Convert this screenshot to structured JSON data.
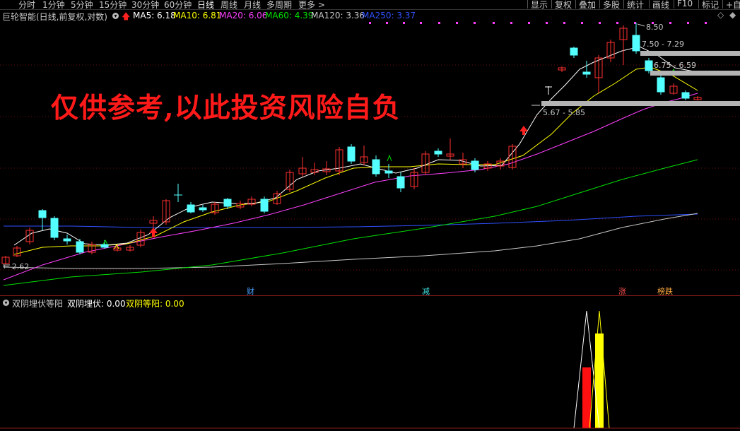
{
  "periods": [
    "分时",
    "1分钟",
    "5分钟",
    "15分钟",
    "30分钟",
    "60分钟",
    "日线",
    "周线",
    "月线",
    "多周期",
    "更多 >"
  ],
  "active_period": "日线",
  "toolbar": [
    "显示",
    "复权",
    "叠加",
    "多股",
    "统计",
    "画线",
    "F10",
    "标记",
    "+自"
  ],
  "stock_title": "巨轮智能(日线,前复权,对数)",
  "ma": [
    {
      "label": "MA5: 6.18",
      "color": "#ffffff"
    },
    {
      "label": "MA10: 6.81",
      "color": "#ffff00"
    },
    {
      "label": "MA20: 6.06",
      "color": "#ff40ff"
    },
    {
      "label": "MA60: 4.39",
      "color": "#00e000"
    },
    {
      "label": "MA120: 3.36",
      "color": "#c8c8c8"
    },
    {
      "label": "MA250: 3.37",
      "color": "#3050ff"
    }
  ],
  "watermark": "仅供参考,以此投资风险自负",
  "price_labels": {
    "high": "8.50",
    "band1": "7.50 - 7.29",
    "band2": "6.75 - 6.59",
    "band3": "5.67 - 5.85",
    "low": "← 2.62"
  },
  "event_tags": [
    {
      "text": "财",
      "color": "#4aa0ff"
    },
    {
      "text": "减",
      "color": "#40e0e0"
    },
    {
      "text": "涨",
      "color": "#ff5050"
    },
    {
      "text": "榜跌",
      "color": "#ffaa40"
    }
  ],
  "indicator": {
    "name": "双阴埋伏等阳",
    "line1": "双阴埋伏: 0.00",
    "line2": "双阴等阳: 0.00"
  },
  "colors": {
    "up": "#ff3030",
    "down": "#54ffff",
    "ma5": "#ffffff",
    "ma10": "#ffff00",
    "ma20": "#ff40ff",
    "ma60": "#00e000",
    "ma120": "#c8c8c8",
    "ma250": "#3050ff"
  }
}
